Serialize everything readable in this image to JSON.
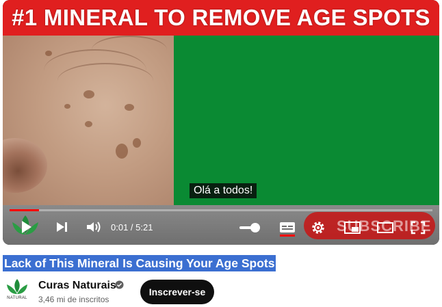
{
  "video": {
    "banner_text": "#1 MINERAL TO REMOVE AGE SPOTS",
    "caption": "Olá a todos!",
    "subscribe_overlay": "SUBSCRIBE",
    "progress_fraction": 0.003
  },
  "controls": {
    "time": "0:01 / 5:21",
    "icons": [
      "play-icon",
      "next-icon",
      "volume-icon",
      "captions-icon",
      "settings-icon",
      "miniplayer-icon",
      "theater-icon",
      "fullscreen-icon"
    ]
  },
  "meta": {
    "title": "Lack of This Mineral Is Causing Your Age Spots",
    "channel_name": "Curas Naturais",
    "subscribers": "3,46 mi de inscritos",
    "subscribe_button": "Inscrever-se",
    "logo_text": "NATURAL"
  },
  "colors": {
    "banner_red": "#e01f1f",
    "background_green": "#0a8a33",
    "progress_red": "#ff0000",
    "title_highlight": "#3b6fd1"
  }
}
